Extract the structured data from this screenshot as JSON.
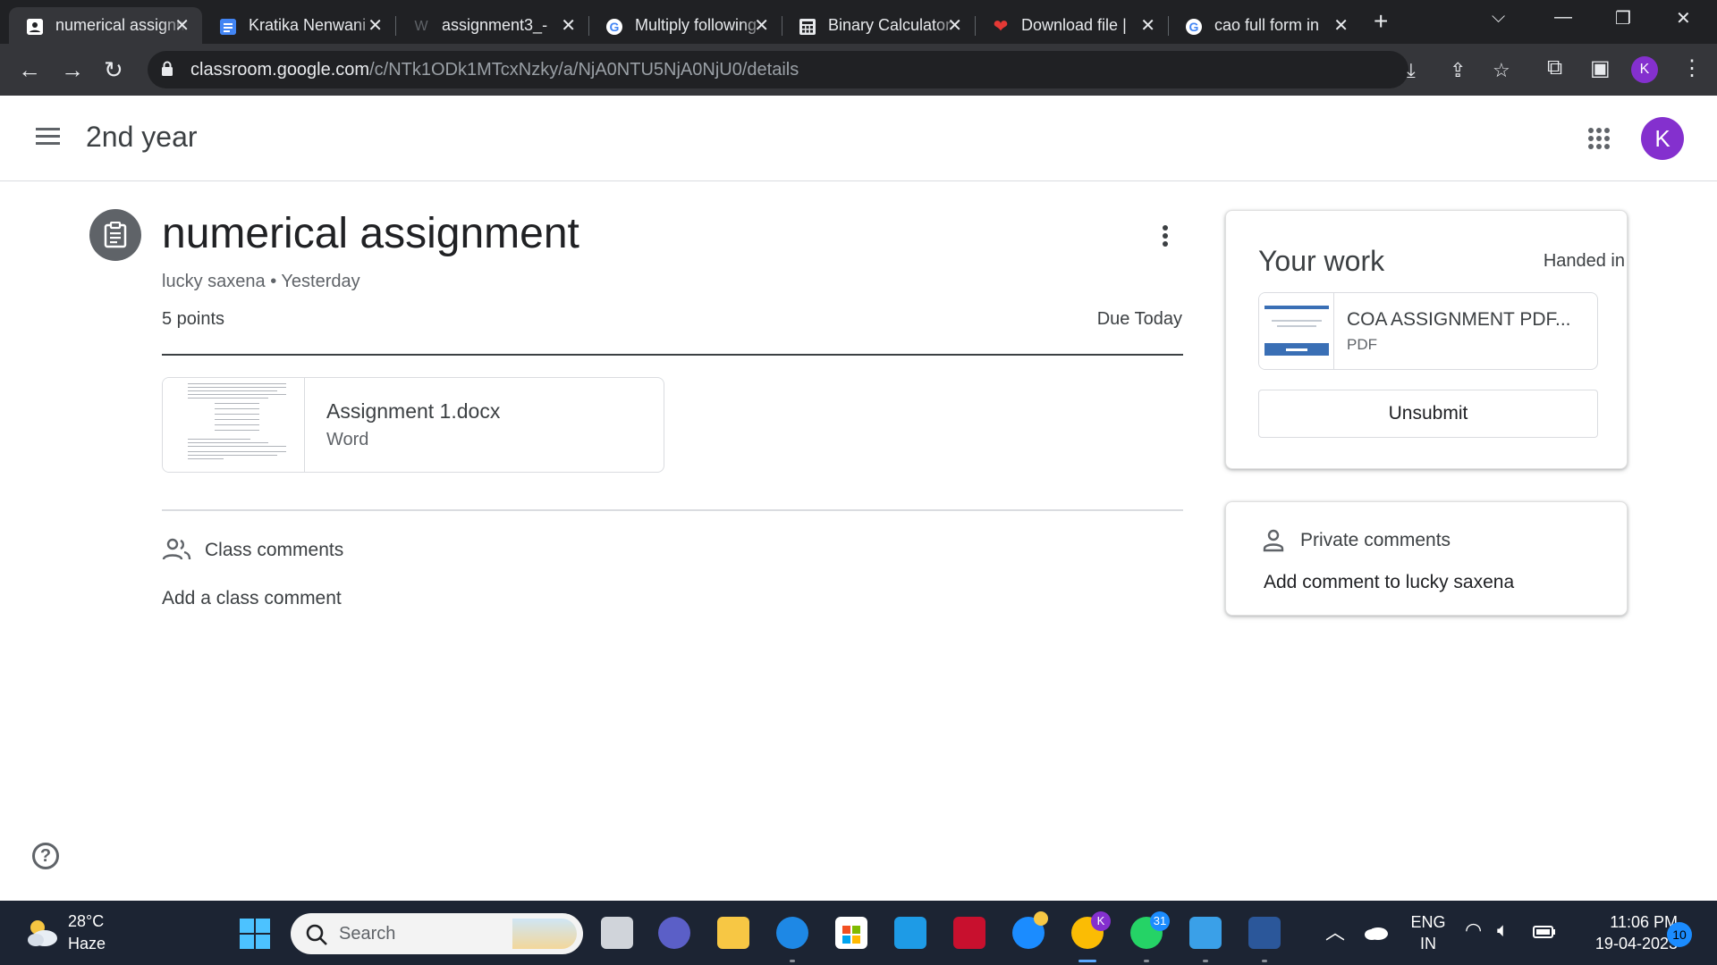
{
  "browser": {
    "tabs": [
      {
        "title": "numerical assignment",
        "favicon": "classroom-icon",
        "color": "#ffffff",
        "active": true
      },
      {
        "title": "Kratika Nenwani",
        "favicon": "docs-icon",
        "color": "#4285f4",
        "active": false
      },
      {
        "title": "assignment3_-",
        "favicon": "word-web-icon",
        "color": "#5f6368",
        "active": false
      },
      {
        "title": "Multiply following",
        "favicon": "google-icon",
        "color": "#ffffff",
        "active": false
      },
      {
        "title": "Binary Calculator",
        "favicon": "calculator-icon",
        "color": "#e8eaed",
        "active": false
      },
      {
        "title": "Download file |",
        "favicon": "heart-icon",
        "color": "#e53935",
        "active": false
      },
      {
        "title": "cao full form in",
        "favicon": "google-icon",
        "color": "#ffffff",
        "active": false
      }
    ],
    "close_glyph": "✕",
    "new_tab_glyph": "+",
    "url_domain": "classroom.google.com",
    "url_path": "/c/NTk1ODk1MTcxNzky/a/NjA0NTU5NjA0NjU0/details",
    "profile_initial": "K"
  },
  "app": {
    "class_name": "2nd year",
    "avatar_initial": "K",
    "accent_color": "#8430ce"
  },
  "assignment": {
    "title": "numerical assignment",
    "author": "lucky saxena",
    "posted": "Yesterday",
    "meta_separator": "•",
    "points": "5 points",
    "due": "Due Today",
    "attachment": {
      "name": "Assignment 1.docx",
      "type": "Word"
    }
  },
  "class_comments": {
    "label": "Class comments",
    "add_prompt": "Add a class comment"
  },
  "your_work": {
    "title": "Your work",
    "status": "Handed in",
    "file": {
      "name": "COA ASSIGNMENT PDF...",
      "type": "PDF"
    },
    "unsubmit_label": "Unsubmit"
  },
  "private_comments": {
    "label": "Private comments",
    "add_prompt": "Add comment to lucky saxena"
  },
  "taskbar": {
    "weather_temp": "28°C",
    "weather_condition": "Haze",
    "search_placeholder": "Search",
    "whatsapp_badge": "31",
    "chrome_profile_badge": "K",
    "language": "ENG",
    "region": "IN",
    "time": "11:06 PM",
    "date": "19-04-2023",
    "notifications": "10"
  }
}
